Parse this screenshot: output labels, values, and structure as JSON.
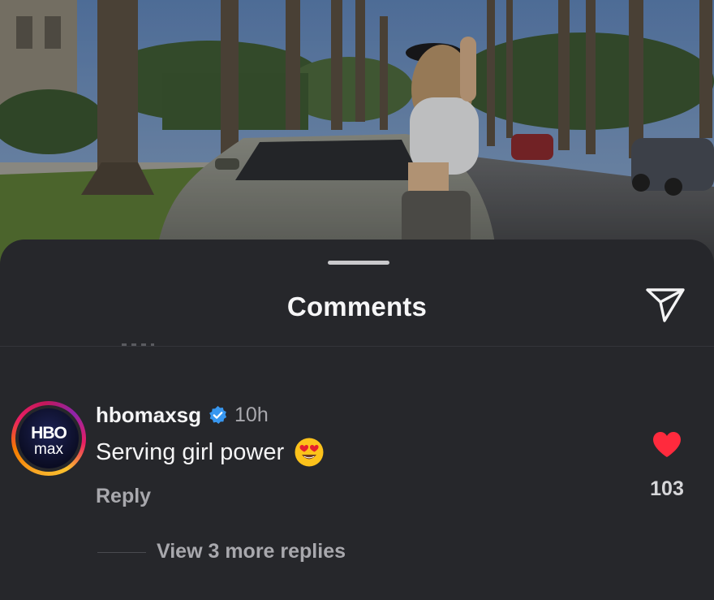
{
  "sheet": {
    "title": "Comments",
    "send_icon": "paper-plane-icon"
  },
  "comments": [
    {
      "username": "hbomaxsg",
      "verified": true,
      "verified_icon": "verified-badge-icon",
      "timestamp": "10h",
      "avatar_logo": {
        "line1": "HBO",
        "line2": "max"
      },
      "text": "Serving girl power",
      "emoji": "😍",
      "emoji_icon": "heart-eyes-emoji-icon",
      "reply_label": "Reply",
      "like_icon": "filled-heart-icon",
      "liked": true,
      "like_count": "103",
      "view_replies_label": "View 3 more replies"
    }
  ],
  "colors": {
    "sheet_bg": "#26272b",
    "like_red": "#ff2a3d",
    "verified_blue": "#3897f0",
    "muted_text": "#a8a8ad"
  }
}
